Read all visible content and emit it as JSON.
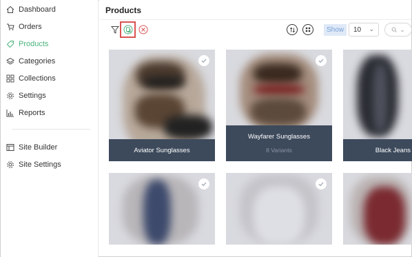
{
  "sidebar": {
    "items": [
      {
        "label": "Dashboard",
        "icon": "home-icon"
      },
      {
        "label": "Orders",
        "icon": "cart-icon"
      },
      {
        "label": "Products",
        "icon": "tag-icon",
        "active": true
      },
      {
        "label": "Categories",
        "icon": "layers-icon"
      },
      {
        "label": "Collections",
        "icon": "grid-icon"
      },
      {
        "label": "Settings",
        "icon": "gear-icon"
      },
      {
        "label": "Reports",
        "icon": "chart-icon"
      }
    ],
    "secondary": [
      {
        "label": "Site Builder",
        "icon": "site-builder-icon"
      },
      {
        "label": "Site Settings",
        "icon": "gear-icon"
      }
    ]
  },
  "header": {
    "title": "Products"
  },
  "toolbar": {
    "show_label": "Show",
    "per_page": "10"
  },
  "products": [
    {
      "name": "Aviator Sunglasses",
      "variants": "",
      "selected": true
    },
    {
      "name": "Wayfarer Sunglasses",
      "variants": "8 Variants",
      "selected": true
    },
    {
      "name": "Black Jeans",
      "variants": "",
      "selected": false
    },
    {
      "name": "",
      "variants": "",
      "selected": true
    },
    {
      "name": "",
      "variants": "",
      "selected": true
    },
    {
      "name": "",
      "variants": "",
      "selected": false
    }
  ],
  "colors": {
    "accent": "#4ab37c",
    "caption_bg": "#3d4a5c",
    "highlight": "#d9534f",
    "cancel": "#e05555"
  }
}
